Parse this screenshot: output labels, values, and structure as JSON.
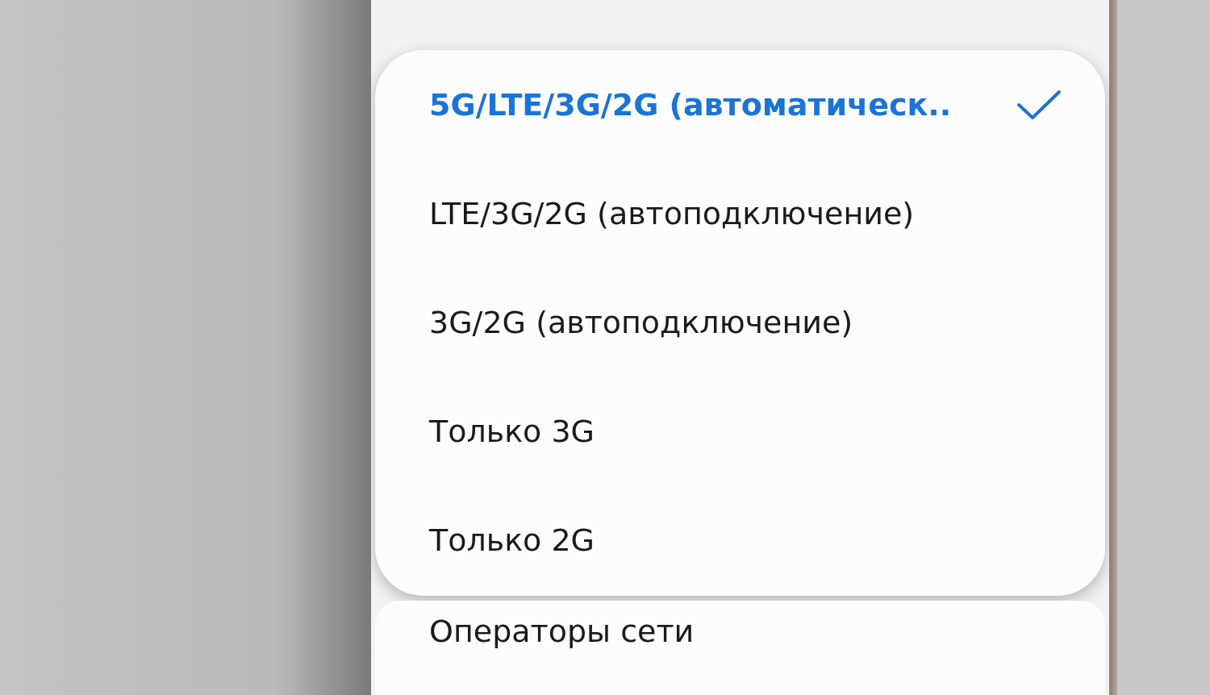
{
  "network_mode_options": [
    {
      "label": "5G/LTE/3G/2G (автоматическ..",
      "selected": true
    },
    {
      "label": "LTE/3G/2G (автоподключение)",
      "selected": false
    },
    {
      "label": "3G/2G (автоподключение)",
      "selected": false
    },
    {
      "label": "Только 3G",
      "selected": false
    },
    {
      "label": "Только 2G",
      "selected": false
    }
  ],
  "menu_items": [
    {
      "label": "Операторы сети"
    }
  ]
}
